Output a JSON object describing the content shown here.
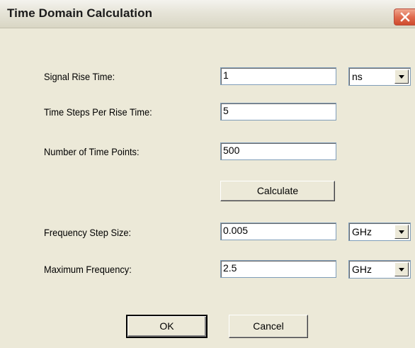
{
  "window": {
    "title": "Time Domain Calculation"
  },
  "fields": {
    "rise_time": {
      "label": "Signal Rise Time:",
      "value": "1",
      "unit": "ns"
    },
    "steps_per_rise": {
      "label": "Time Steps Per Rise Time:",
      "value": "5"
    },
    "num_points": {
      "label": "Number of Time Points:",
      "value": "500"
    },
    "freq_step": {
      "label": "Frequency Step Size:",
      "value": "0.005",
      "unit": "GHz"
    },
    "max_freq": {
      "label": "Maximum Frequency:",
      "value": "2.5",
      "unit": "GHz"
    }
  },
  "buttons": {
    "calculate": "Calculate",
    "ok": "OK",
    "cancel": "Cancel"
  },
  "icons": {
    "close": "close-icon",
    "dropdown": "chevron-down-icon"
  },
  "colors": {
    "dialog_bg": "#ece9d8",
    "close_button": "#e06c50",
    "field_border": "#7f9db9"
  }
}
